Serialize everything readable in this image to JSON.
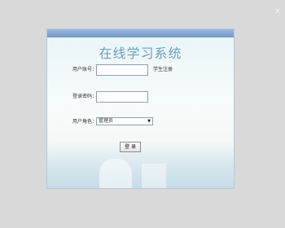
{
  "window": {
    "close_icon": "close-icon"
  },
  "login": {
    "title": "在线学习系统",
    "username_label": "用户账号：",
    "username_value": "",
    "register_link": "学生注册",
    "password_label": "登录密码：",
    "password_value": "",
    "role_label": "用户角色：",
    "role_selected": "管理员",
    "login_button": "登 录"
  },
  "colors": {
    "background": "#d9d9d9",
    "title": "#6c9fbe",
    "topbar": "#7f9fcf",
    "panel": "#f6fbfb"
  }
}
